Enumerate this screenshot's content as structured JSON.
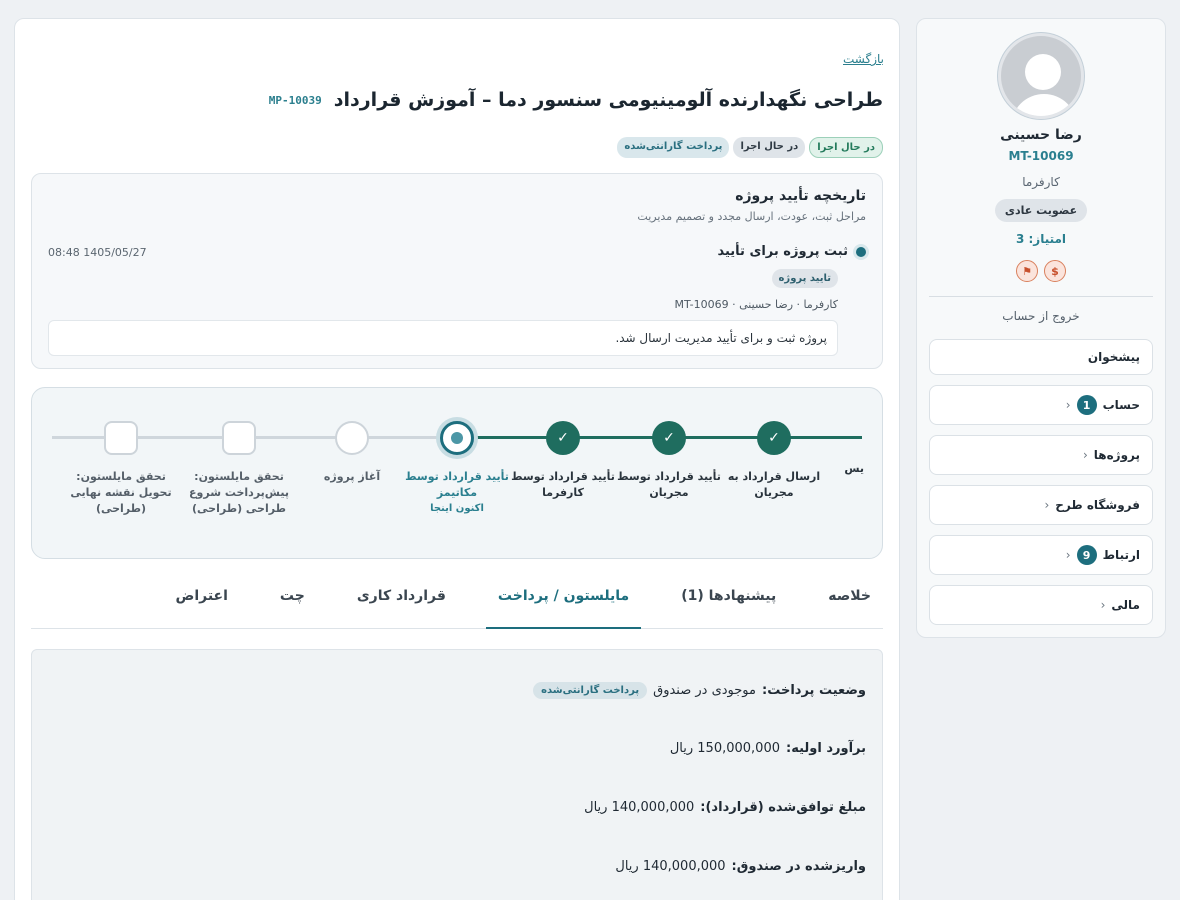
{
  "user": {
    "name": "رضا حسینی",
    "code": "MT-10069",
    "role": "کارفرما",
    "membership": "عضویت عادی",
    "score": "امتیاز: 3",
    "logout": "خروج از حساب"
  },
  "menu": [
    {
      "label": "پیشخوان"
    },
    {
      "label": "حساب",
      "count": "1"
    },
    {
      "label": "پروژه‌ها"
    },
    {
      "label": "فروشگاه طرح"
    },
    {
      "label": "ارتباط",
      "count": "9"
    },
    {
      "label": "مالی"
    }
  ],
  "header": {
    "back": "بازگشت",
    "title": "طراحی نگهدارنده آلومینیومی سنسور دما – آموزش قرارداد",
    "code": "MP-10039",
    "chips": [
      "در حال اجرا",
      "در حال اجرا",
      "پرداخت گارانتی‌شده"
    ]
  },
  "history": {
    "title": "تاریخچه تأیید پروژه",
    "subtitle": "مراحل ثبت، عودت، ارسال مجدد و تصمیم مدیریت",
    "event_title": "ثبت پروژه برای تأیید",
    "event_time": "08:48 1405/05/27",
    "event_chip": "تایید پروژه",
    "event_actor": "کارفرما · رضا حسینی · MT-10069",
    "event_note": "پروژه ثبت و برای تأیید مدیریت ارسال شد."
  },
  "steps": {
    "cut_label": "یس",
    "items": [
      {
        "label": "ارسال قرارداد به مجریان",
        "state": "done"
      },
      {
        "label": "تأیید قرارداد توسط مجریان",
        "state": "done"
      },
      {
        "label": "تأیید قرارداد توسط کارفرما",
        "state": "done"
      },
      {
        "label": "تأیید قرارداد توسط مکاتیمز",
        "state": "current",
        "here": "اکنون اینجا"
      },
      {
        "label": "آغاز پروژه",
        "state": "pending"
      },
      {
        "label": "تحقق مایلستون: پیش‌پرداخت شروع طراحی (طراحی)",
        "state": "pending-sq"
      },
      {
        "label": "تحقق مایلستون: تحویل نقشه نهایی (طراحی)",
        "state": "pending-sq"
      }
    ]
  },
  "tabs": [
    "خلاصه",
    "پیشنهادها (1)",
    "مایلستون / پرداخت",
    "قرارداد کاری",
    "چت",
    "اعتراض"
  ],
  "active_tab": "مایلستون / پرداخت",
  "payment": {
    "status_label": "وضعیت پرداخت:",
    "status_value": "موجودی در صندوق",
    "status_chip": "پرداخت گارانتی‌شده",
    "initial_label": "برآورد اولیه:",
    "initial_value": "150,000,000 ریال",
    "agreed_label": "مبلغ توافق‌شده (قرارداد):",
    "agreed_value": "140,000,000 ریال",
    "deposited_label": "واریزشده در صندوق:",
    "deposited_value": "140,000,000 ریال"
  },
  "colors": {
    "accent": "#1d6e7e",
    "done": "#1f6d5f",
    "badge": "#d9805d"
  },
  "icons": [
    "user-avatar-icon",
    "flag-icon",
    "coin-icon",
    "chevron-left-icon",
    "check-icon"
  ]
}
